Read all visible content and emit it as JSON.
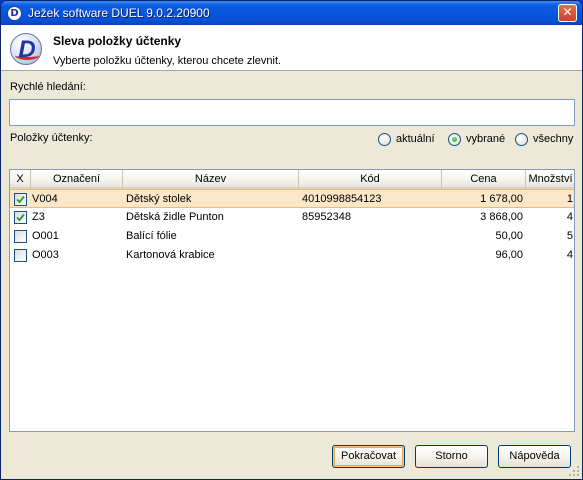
{
  "window": {
    "title": "Ježek software DUEL 9.0.2.20900",
    "close_symbol": "✕",
    "app_icon_letter": "D"
  },
  "header": {
    "logo_letter": "D",
    "title": "Sleva položky účtenky",
    "subtitle": "Vyberte položku účtenky, kterou chcete zlevnit."
  },
  "search": {
    "label": "Rychlé hledání:",
    "value": "",
    "placeholder": ""
  },
  "items_section": {
    "label": "Položky účtenky:",
    "filter_options": [
      {
        "label": "aktuální",
        "checked": false
      },
      {
        "label": "vybrané",
        "checked": true
      },
      {
        "label": "všechny",
        "checked": false
      }
    ]
  },
  "grid": {
    "columns": [
      "X",
      "Označení",
      "Název",
      "Kód",
      "Cena",
      "Množství"
    ],
    "rows": [
      {
        "checked": true,
        "code": "V004",
        "name": "Dětský stolek",
        "ean": "4010998854123",
        "price": "1 678,00",
        "qty": "1",
        "selected": true
      },
      {
        "checked": true,
        "code": "Z3",
        "name": "Dětská židle Punton",
        "ean": "85952348",
        "price": "3 868,00",
        "qty": "4",
        "selected": false
      },
      {
        "checked": false,
        "code": "O001",
        "name": "Balící fólie",
        "ean": "",
        "price": "50,00",
        "qty": "5",
        "selected": false
      },
      {
        "checked": false,
        "code": "O003",
        "name": "Kartonová krabice",
        "ean": "",
        "price": "96,00",
        "qty": "4",
        "selected": false
      }
    ]
  },
  "buttons": {
    "continue": "Pokračovat",
    "cancel": "Storno",
    "help": "Nápověda"
  },
  "colors": {
    "selected_row": "#fde7c8",
    "titlebar": "#0654dd",
    "checkbox_check": "#21a121"
  }
}
